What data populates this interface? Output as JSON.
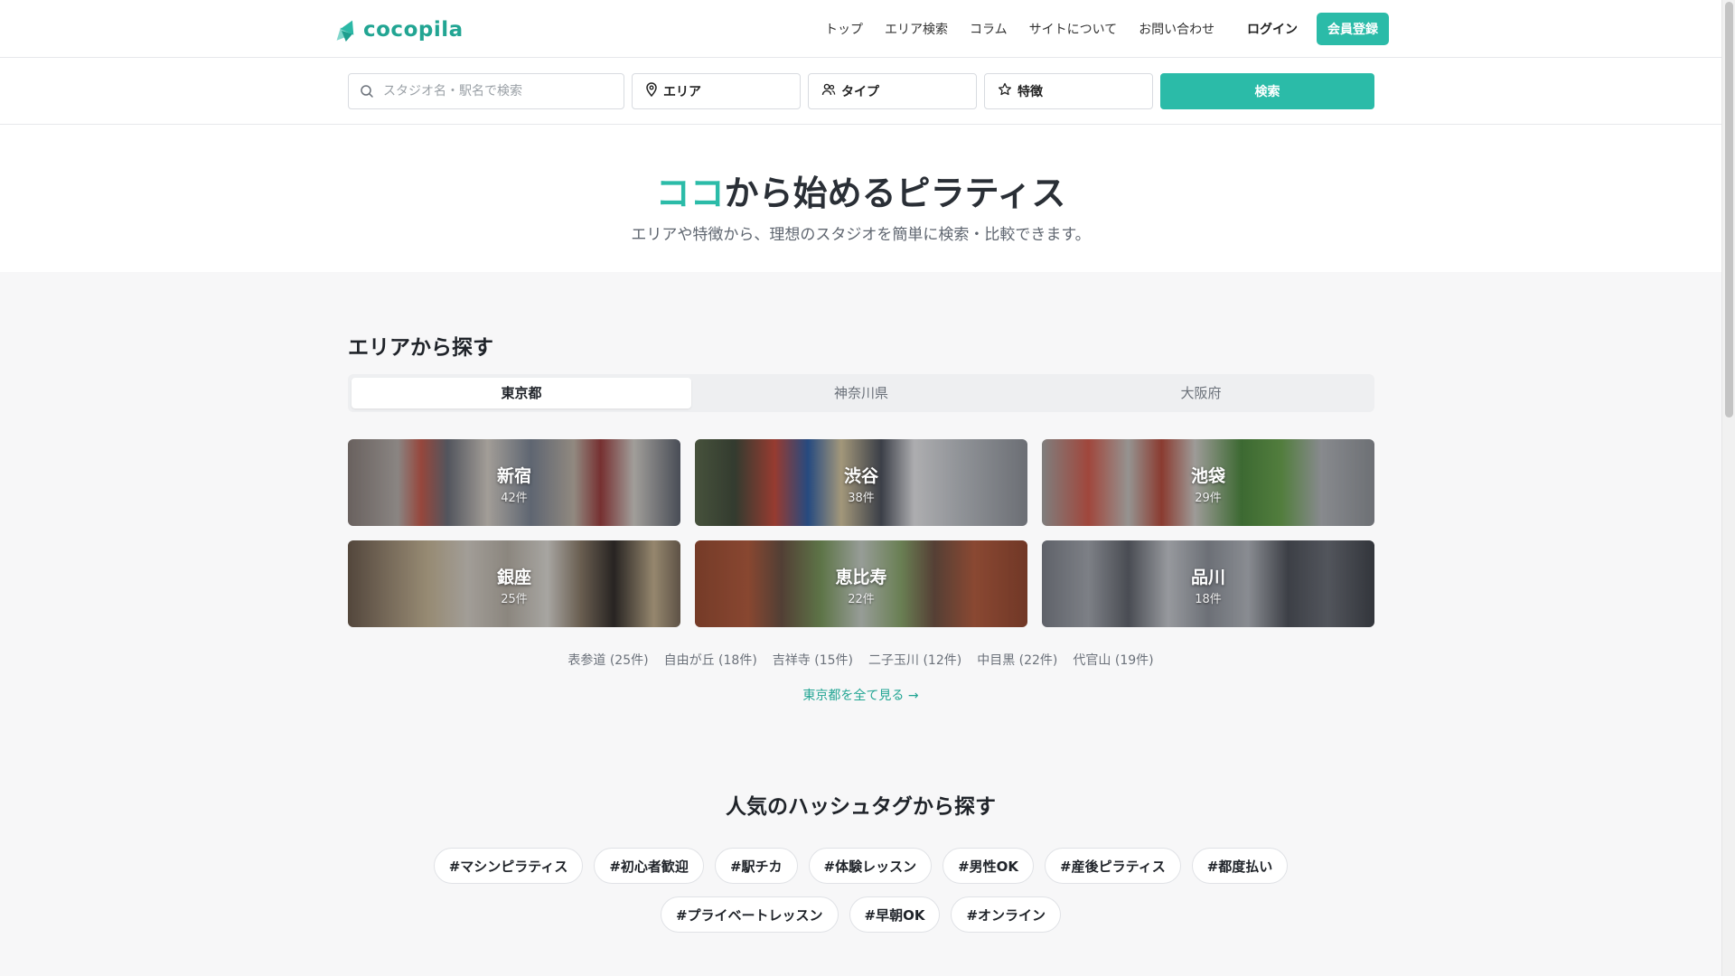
{
  "header": {
    "logo_text": "cocopila",
    "nav": [
      "トップ",
      "エリア検索",
      "コラム",
      "サイトについて",
      "お問い合わせ"
    ],
    "login_label": "ログイン",
    "signup_label": "会員登録"
  },
  "search": {
    "placeholder": "スタジオ名・駅名で検索",
    "value": "",
    "area_label": "エリア",
    "type_label": "タイプ",
    "feature_label": "特徴",
    "button_label": "検索"
  },
  "hero": {
    "title_accent": "ココ",
    "title_rest": "から始めるピラティス",
    "subtitle": "エリアや特徴から、理想のスタジオを簡単に検索・比較できます。"
  },
  "area": {
    "section_title": "エリアから探す",
    "tabs": [
      {
        "label": "東京都",
        "active": true
      },
      {
        "label": "神奈川県",
        "active": false
      },
      {
        "label": "大阪府",
        "active": false
      }
    ],
    "cities": [
      {
        "name": "新宿",
        "count": "42件"
      },
      {
        "name": "渋谷",
        "count": "38件"
      },
      {
        "name": "池袋",
        "count": "29件"
      },
      {
        "name": "銀座",
        "count": "25件"
      },
      {
        "name": "恵比寿",
        "count": "22件"
      },
      {
        "name": "品川",
        "count": "18件"
      }
    ],
    "sub_areas": [
      "表参道 (25件)",
      "自由が丘 (18件)",
      "吉祥寺 (15件)",
      "二子玉川 (12件)",
      "中目黒 (22件)",
      "代官山 (19件)"
    ],
    "see_all_label": "東京都を全て見る →"
  },
  "hashtags": {
    "title": "人気のハッシュタグから探す",
    "row1": [
      "#マシンピラティス",
      "#初心者歓迎",
      "#駅チカ",
      "#体験レッスン",
      "#男性OK",
      "#産後ピラティス",
      "#都度払い"
    ],
    "row2": [
      "#プライベートレッスン",
      "#早朝OK",
      "#オンライン"
    ]
  },
  "colors": {
    "accent": "#2bbba8",
    "accent_text": "#22a593",
    "section_bg": "#f7f7f8"
  }
}
